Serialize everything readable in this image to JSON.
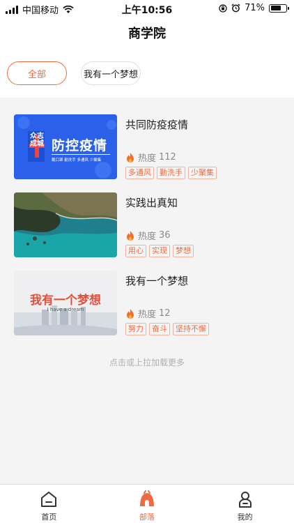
{
  "status_bar": {
    "carrier": "中国移动",
    "time": "上午10:56",
    "battery": "71%",
    "battery_level": 0.71
  },
  "header": {
    "title": "商学院"
  },
  "filters": [
    {
      "label": "全部",
      "active": true
    },
    {
      "label": "我有一个梦想",
      "active": false
    }
  ],
  "articles": [
    {
      "title": "共同防疫疫情",
      "heat_label": "热度",
      "heat_value": "112",
      "tags": [
        "多通风",
        "勤洗手",
        "少聚集"
      ],
      "thumb_text": "防控疫情",
      "thumb_side_text": "众志成城",
      "thumb_sub": "戴口罩  勤洗手  多通风  少聚集"
    },
    {
      "title": "实践出真知",
      "heat_label": "热度",
      "heat_value": "36",
      "tags": [
        "用心",
        "实现",
        "梦想"
      ]
    },
    {
      "title": "我有一个梦想",
      "heat_label": "热度",
      "heat_value": "12",
      "tags": [
        "努力",
        "奋斗",
        "坚持不懈"
      ],
      "thumb_text": "我有一个梦想",
      "thumb_sub": "I have a dream"
    }
  ],
  "load_more": "点击或上拉加载更多",
  "tabs": [
    {
      "label": "首页",
      "icon": "home-icon",
      "active": false
    },
    {
      "label": "部落",
      "icon": "tribe-icon",
      "active": true
    },
    {
      "label": "我的",
      "icon": "profile-icon",
      "active": false
    }
  ],
  "colors": {
    "accent": "#ef6b3f",
    "background": "#f4f4f4"
  }
}
